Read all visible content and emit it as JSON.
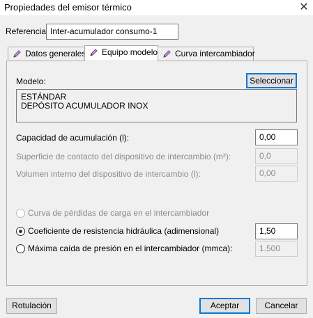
{
  "window": {
    "title": "Propiedades del emisor térmico"
  },
  "referencia": {
    "label": "Referencia:",
    "value": "Inter-acumulador consumo-1"
  },
  "tabs": [
    {
      "label": "Datos generales",
      "active": false
    },
    {
      "label": "Equipo modelo",
      "active": true
    },
    {
      "label": "Curva intercambiador",
      "active": false
    }
  ],
  "modelo": {
    "label": "Modelo:",
    "select_label": "Seleccionar",
    "line1": "ESTÁNDAR",
    "line2": "DEPÓSITO ACUMULADOR INOX"
  },
  "fields": {
    "capacidad": {
      "label": "Capacidad de acumulación (l):",
      "value": "0,00"
    },
    "superficie": {
      "label": "Superficie de contacto del dispositivo de intercambio (m²):",
      "value": "0,0"
    },
    "volumen": {
      "label": "Volumen interno del dispositivo de intercambio (l):",
      "value": "0,00"
    }
  },
  "options": {
    "curva": {
      "label": "Curva de pérdidas de carga en el intercambiador"
    },
    "coeficiente": {
      "label": "Coeficiente de resistencia hidráulica (adimensional)",
      "value": "1,50"
    },
    "maxima": {
      "label": "Máxima caída de presión en el intercambiador (mmca):",
      "value": "1.500"
    }
  },
  "buttons": {
    "rotulacion": "Rotulación",
    "aceptar": "Aceptar",
    "cancelar": "Cancelar"
  },
  "colors": {
    "accent": "#0078d7",
    "window_bg": "#f0f0f0",
    "disabled_text": "#8a8a8a"
  }
}
